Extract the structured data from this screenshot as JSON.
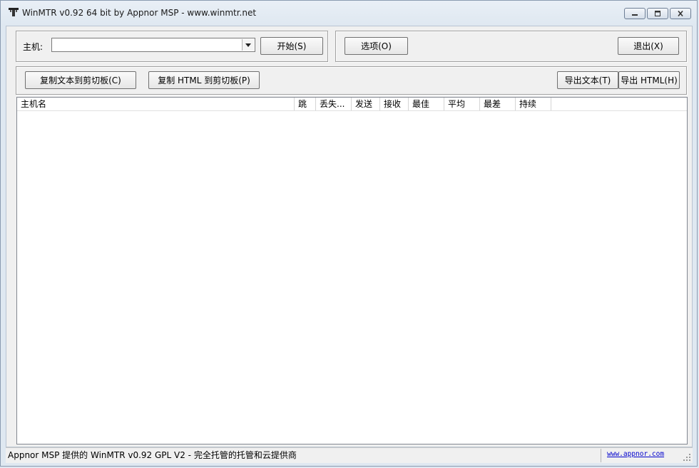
{
  "window": {
    "title": "WinMTR v0.92 64 bit by Appnor MSP - www.winmtr.net",
    "icon": "winmtr-app-icon"
  },
  "host_row": {
    "host_label": "主机:",
    "host_value": "",
    "start_button": "开始(S)",
    "options_button": "选项(O)",
    "exit_button": "退出(X)"
  },
  "actions_row": {
    "copy_text_button": "复制文本到剪切板(C)",
    "copy_html_button": "复制 HTML 到剪切板(P)",
    "export_text_button": "导出文本(T)",
    "export_html_button": "导出 HTML(H)"
  },
  "table": {
    "columns": [
      "主机名",
      "跳",
      "丢失...",
      "发送",
      "接收",
      "最佳",
      "平均",
      "最差",
      "持续"
    ],
    "rows": []
  },
  "statusbar": {
    "message": "Appnor MSP 提供的 WinMTR v0.92 GPL V2 - 完全托管的托管和云提供商",
    "link": "www.appnor.com"
  }
}
